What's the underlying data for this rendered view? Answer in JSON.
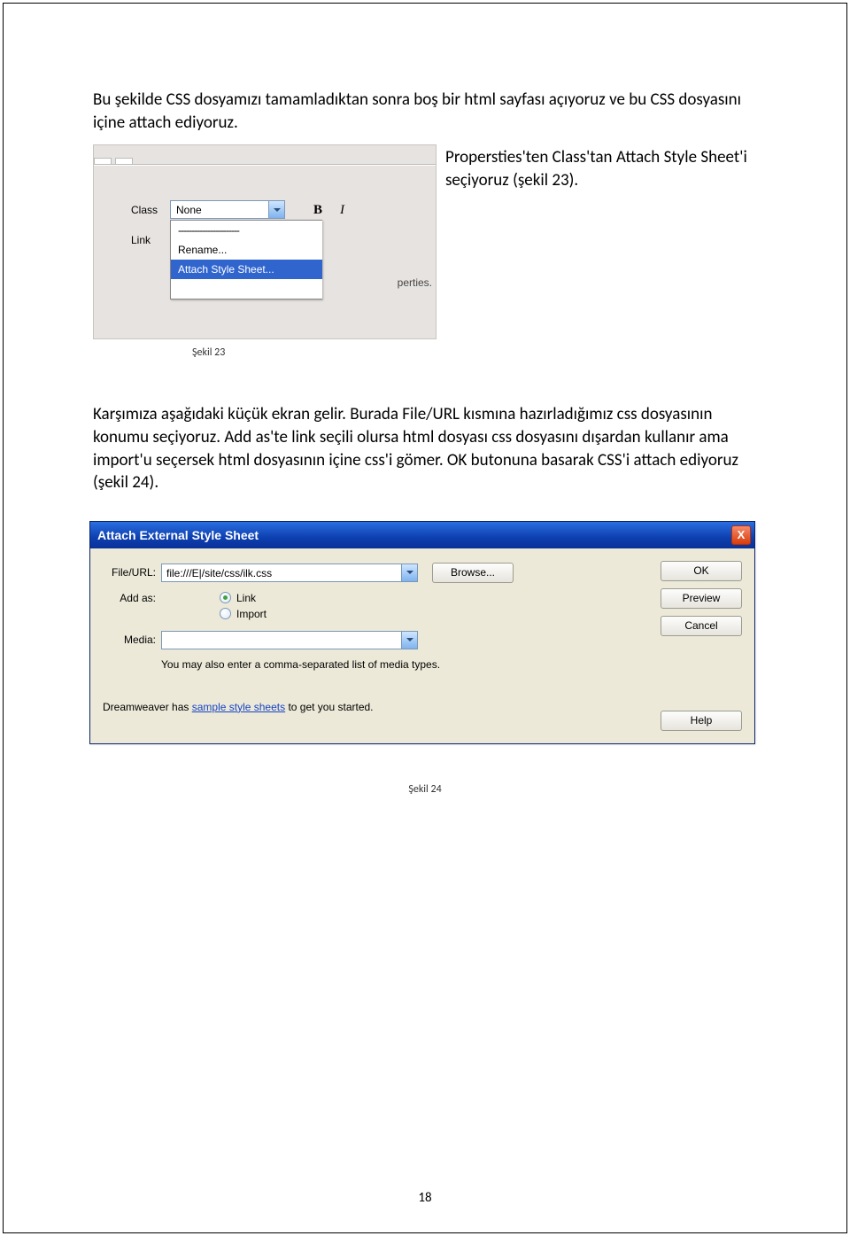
{
  "paragraph1": "Bu şekilde CSS dosyamızı tamamladıktan sonra boş bir html sayfası açıyoruz ve bu CSS dosyasını içine attach ediyoruz.",
  "side_text": "Propersties'ten Class'tan Attach Style Sheet'i seçiyoruz (şekil 23).",
  "caption1": "Şekil 23",
  "shot1": {
    "label_class": "Class",
    "label_link": "Link",
    "class_value": "None",
    "opt_dashes": "-----------------------",
    "opt_rename": "Rename...",
    "opt_attach": "Attach Style Sheet...",
    "prop_label": "perties."
  },
  "paragraph2": "Karşımıza aşağıdaki küçük ekran gelir. Burada File/URL kısmına hazırladığımız css dosyasının konumu seçiyoruz. Add as'te link seçili olursa html dosyası css dosyasını dışardan kullanır ama import'u seçersek html dosyasının içine css'i gömer. OK butonuna basarak CSS'i attach ediyoruz (şekil 24).",
  "dialog": {
    "title": "Attach External Style Sheet",
    "close": "X",
    "label_fileurl": "File/URL:",
    "fileurl_value": "file:///E|/site/css/ilk.css",
    "browse": "Browse...",
    "label_addas": "Add as:",
    "radio_link": "Link",
    "radio_import": "Import",
    "label_media": "Media:",
    "media_value": "",
    "note": "You may also enter a comma-separated list of media types.",
    "note2_pre": "Dreamweaver has ",
    "note2_link": "sample style sheets",
    "note2_post": " to get you started.",
    "ok": "OK",
    "preview": "Preview",
    "cancel": "Cancel",
    "help": "Help"
  },
  "caption2": "Şekil 24",
  "page_number": "18"
}
